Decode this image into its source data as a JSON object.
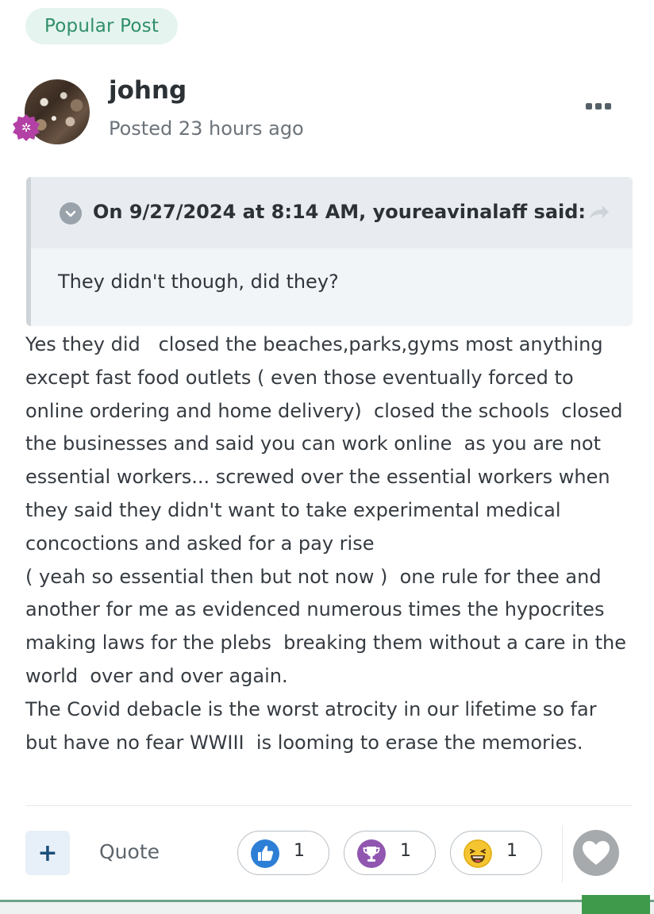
{
  "post": {
    "badge": "Popular Post",
    "author": "johng",
    "posted": "Posted 23 hours ago",
    "quote": {
      "citation": "On 9/27/2024 at 8:14 AM, youreavinalaff said:",
      "text": "They didn't though, did they?"
    },
    "body_lines": [
      "Yes they did   closed the beaches,parks,gyms most anything",
      "except fast food outlets ( even those eventually forced to",
      "online ordering and home delivery)  closed the schools  closed",
      "the businesses and said you can work online  as you are not",
      "essential workers... screwed over the essential workers when",
      "they said they didn't want to take experimental medical",
      "concoctions and asked for a pay rise",
      "( yeah so essential then but not now )  one rule for thee and",
      "another for me as evidenced numerous times the hypocrites",
      "making laws for the plebs  breaking them without a care in the",
      "world  over and over again.",
      "The Covid debacle is the worst atrocity in our lifetime so far",
      "but have no fear WWIII  is looming to erase the memories."
    ]
  },
  "actions": {
    "plus": "+",
    "quote_label": "Quote",
    "reactions": [
      {
        "icon": "thumbs-up-icon",
        "count": "1",
        "color": "#2d7fd6"
      },
      {
        "icon": "trophy-icon",
        "count": "1",
        "color": "#9156b0"
      },
      {
        "icon": "laughing-face-icon",
        "count": "1",
        "color": "#f5c531"
      }
    ]
  },
  "colors": {
    "accent_green": "#2f8f6a",
    "badge_bg": "#e6f4ef",
    "rank_badge": "#b340a4"
  }
}
